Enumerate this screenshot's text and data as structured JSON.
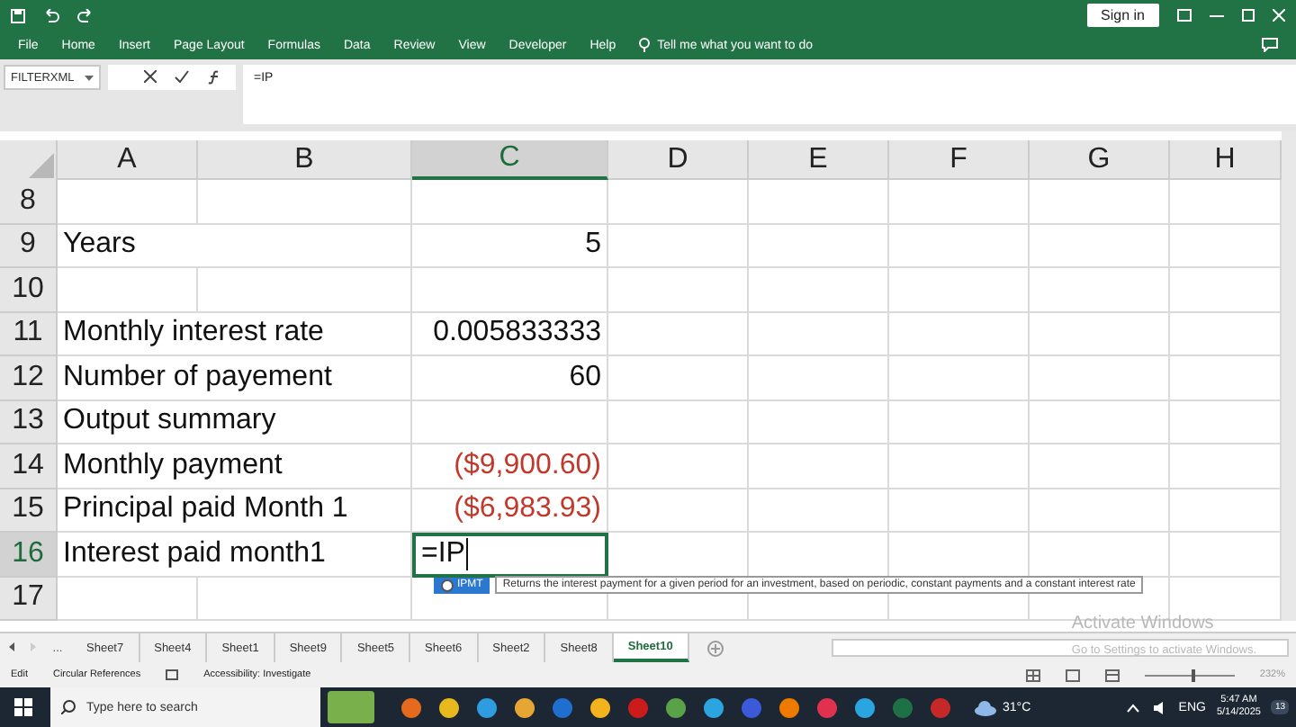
{
  "title_bar": {
    "sign_in": "Sign in"
  },
  "ribbon_tabs": [
    {
      "label": "File"
    },
    {
      "label": "Home"
    },
    {
      "label": "Insert"
    },
    {
      "label": "Page Layout"
    },
    {
      "label": "Formulas"
    },
    {
      "label": "Data"
    },
    {
      "label": "Review"
    },
    {
      "label": "View"
    },
    {
      "label": "Developer"
    },
    {
      "label": "Help"
    }
  ],
  "tell_me": "Tell me what you want to do",
  "formula_bar": {
    "name_box": "FILTERXML",
    "formula": "=IP"
  },
  "columns": [
    {
      "label": "A",
      "selected": false
    },
    {
      "label": "B",
      "selected": false
    },
    {
      "label": "C",
      "selected": true
    },
    {
      "label": "D",
      "selected": false
    },
    {
      "label": "E",
      "selected": false
    },
    {
      "label": "F",
      "selected": false
    },
    {
      "label": "G",
      "selected": false
    },
    {
      "label": "H",
      "selected": false
    }
  ],
  "rows": [
    {
      "header": "8"
    },
    {
      "header": "9",
      "A": {
        "text": "Years",
        "kind": "text"
      },
      "C": {
        "text": "5",
        "kind": "number"
      }
    },
    {
      "header": "10"
    },
    {
      "header": "11",
      "A": {
        "text": "Monthly interest rate",
        "kind": "text"
      },
      "C": {
        "text": "0.005833333",
        "kind": "number"
      }
    },
    {
      "header": "12",
      "A": {
        "text": "Number of payement",
        "kind": "text"
      },
      "C": {
        "text": "60",
        "kind": "number"
      }
    },
    {
      "header": "13",
      "A": {
        "text": "Output summary",
        "kind": "text"
      }
    },
    {
      "header": "14",
      "A": {
        "text": "Monthly payment",
        "kind": "text"
      },
      "C": {
        "text": "($9,900.60)",
        "kind": "negative"
      }
    },
    {
      "header": "15",
      "A": {
        "text": "Principal paid Month 1",
        "kind": "text"
      },
      "C": {
        "text": "($6,983.93)",
        "kind": "negative"
      }
    },
    {
      "header": "16",
      "A": {
        "text": "Interest paid month1",
        "kind": "text"
      },
      "C": {
        "text": "=IP",
        "kind": "editing"
      }
    },
    {
      "header": "17"
    }
  ],
  "autocomplete": {
    "function": "IPMT",
    "description": "Returns the interest payment for a given period for an investment, based on periodic, constant payments and a constant interest rate"
  },
  "activation_notice": {
    "title": "Activate Windows",
    "hint": "Go to Settings to activate Windows."
  },
  "sheet_tabs": {
    "more": "...",
    "tabs": [
      {
        "label": "Sheet7",
        "selected": false
      },
      {
        "label": "Sheet4",
        "selected": false
      },
      {
        "label": "Sheet1",
        "selected": false
      },
      {
        "label": "Sheet9",
        "selected": false
      },
      {
        "label": "Sheet5",
        "selected": false
      },
      {
        "label": "Sheet6",
        "selected": false
      },
      {
        "label": "Sheet2",
        "selected": false
      },
      {
        "label": "Sheet8",
        "selected": false
      },
      {
        "label": "Sheet10",
        "selected": true
      }
    ]
  },
  "status_bar": {
    "mode": "Edit",
    "circular": "Circular References",
    "accessibility": "Accessibility: Investigate",
    "zoom": "232%",
    "zoom_slider": {
      "level": 0.55
    }
  },
  "taskbar": {
    "search_placeholder": "Type here to search",
    "temperature": "31°C",
    "language": "ENG",
    "time": "5:47 AM",
    "date": "5/14/2025",
    "notifications": "13"
  }
}
